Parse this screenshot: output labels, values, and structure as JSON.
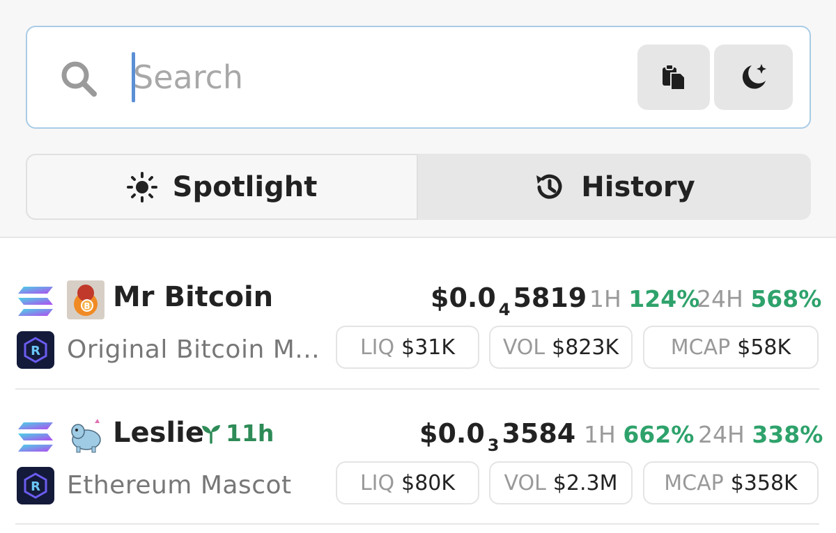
{
  "search": {
    "placeholder": "Search",
    "paste_icon": "clipboard-icon",
    "theme_icon": "moon-star-icon"
  },
  "tabs": [
    {
      "label": "Spotlight",
      "icon": "sun-icon",
      "active": true
    },
    {
      "label": "History",
      "icon": "history-icon",
      "active": false
    }
  ],
  "colors": {
    "positive": "#2ea26b",
    "search_border": "#a9cce6",
    "caret": "#5b8fd6"
  },
  "tokens": [
    {
      "chain_icon": "solana-icon",
      "dex_icon": "raydium-icon",
      "name": "Mr Bitcoin",
      "full_name": "Original Bitcoin M...",
      "age": "",
      "price_prefix": "$0.0",
      "price_zeros": "4",
      "price_digits": "5819",
      "h1_label": "1H",
      "h1_change": "124%",
      "h24_label": "24H",
      "h24_change": "568%",
      "liq_label": "LIQ",
      "liq": "$31K",
      "vol_label": "VOL",
      "vol": "$823K",
      "mcap_label": "MCAP",
      "mcap": "$58K"
    },
    {
      "chain_icon": "solana-icon",
      "dex_icon": "raydium-icon",
      "name": "Leslie",
      "full_name": "Ethereum Mascot",
      "age": "11h",
      "age_icon": "sprout-icon",
      "price_prefix": "$0.0",
      "price_zeros": "3",
      "price_digits": "3584",
      "h1_label": "1H",
      "h1_change": "662%",
      "h24_label": "24H",
      "h24_change": "338%",
      "liq_label": "LIQ",
      "liq": "$80K",
      "vol_label": "VOL",
      "vol": "$2.3M",
      "mcap_label": "MCAP",
      "mcap": "$358K"
    }
  ]
}
